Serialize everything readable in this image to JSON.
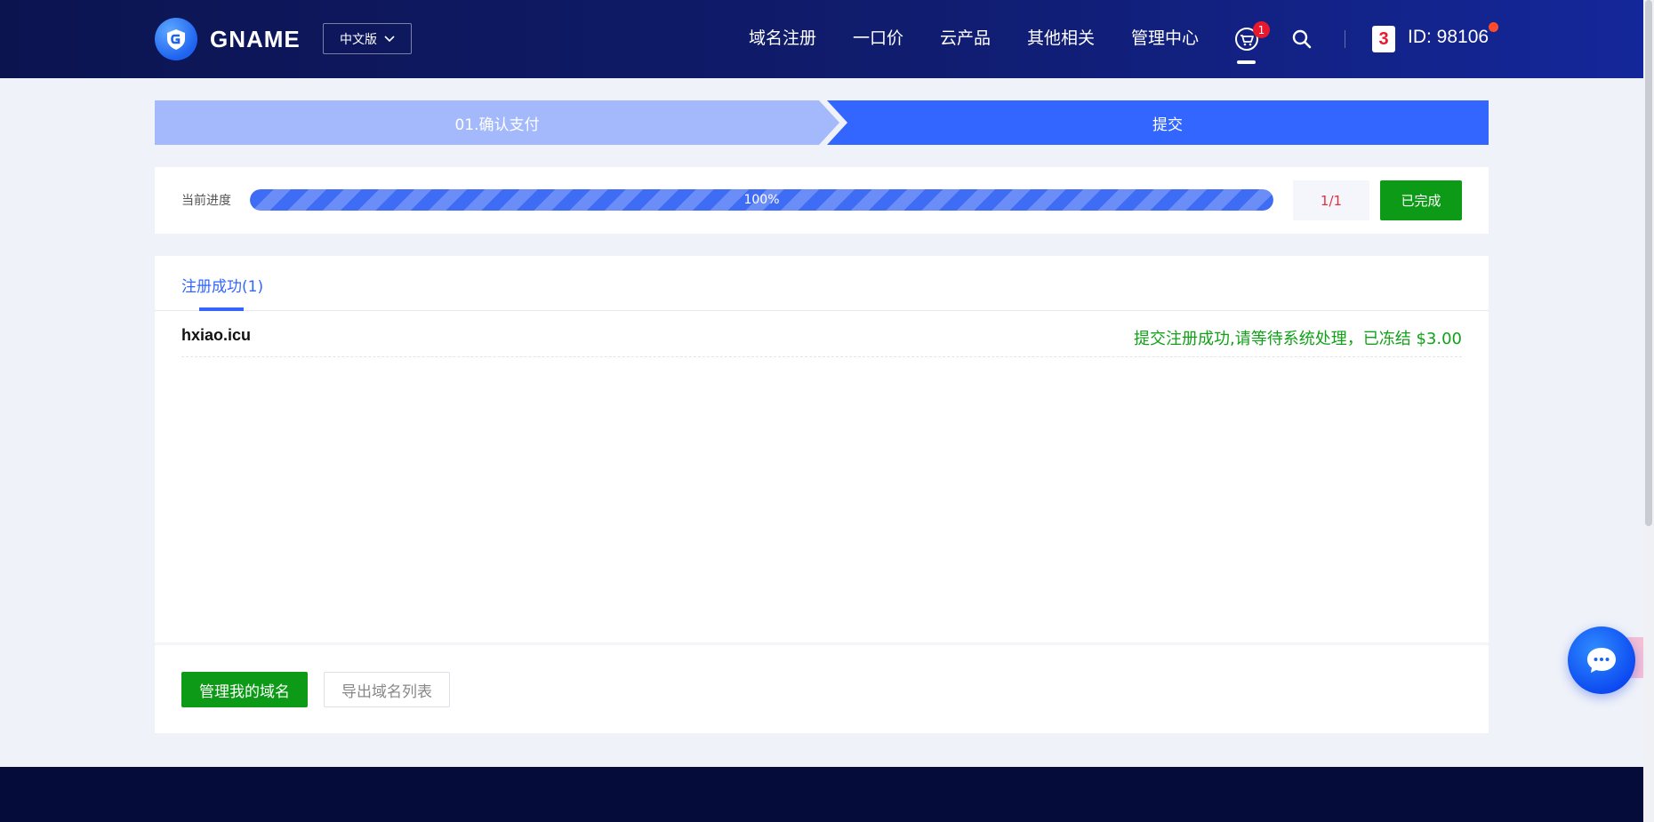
{
  "header": {
    "logo_text": "GNAME",
    "lang": "中文版",
    "nav": [
      "域名注册",
      "一口价",
      "云产品",
      "其他相关",
      "管理中心"
    ],
    "cart_count": "1",
    "avatar_text": "3",
    "user_id": "ID: 98106"
  },
  "steps": {
    "step1": "01.确认支付",
    "step2": "提交"
  },
  "progress": {
    "label": "当前进度",
    "percent": 100,
    "percent_text": "100%",
    "count": "1/1",
    "done_label": "已完成"
  },
  "results": {
    "tab_label": "注册成功(1)",
    "rows": [
      {
        "domain": "hxiao.icu",
        "status": "提交注册成功,请等待系统处理，已冻结 $3.00"
      }
    ]
  },
  "actions": {
    "manage": "管理我的域名",
    "export": "导出域名列表"
  },
  "colors": {
    "primary": "#3366ff",
    "success": "#0c9a17",
    "header_bg": "#0c1450"
  }
}
